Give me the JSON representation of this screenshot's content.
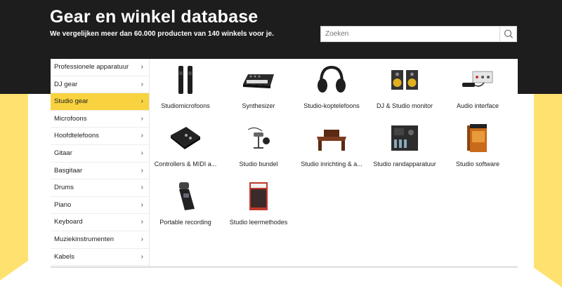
{
  "header": {
    "title": "Gear en winkel database",
    "subtitle": "We vergelijken meer dan 60.000 producten van 140 winkels voor je."
  },
  "search": {
    "placeholder": "Zoeken",
    "icon": "search-icon"
  },
  "sidebar": {
    "items": [
      {
        "label": "Professionele apparatuur",
        "active": false
      },
      {
        "label": "DJ gear",
        "active": false
      },
      {
        "label": "Studio gear",
        "active": true
      },
      {
        "label": "Microfoons",
        "active": false
      },
      {
        "label": "Hoofdtelefoons",
        "active": false
      },
      {
        "label": "Gitaar",
        "active": false
      },
      {
        "label": "Basgitaar",
        "active": false
      },
      {
        "label": "Drums",
        "active": false
      },
      {
        "label": "Piano",
        "active": false
      },
      {
        "label": "Keyboard",
        "active": false
      },
      {
        "label": "Muziekinstrumenten",
        "active": false
      },
      {
        "label": "Kabels",
        "active": false
      }
    ],
    "chevron": "chevron-right-icon"
  },
  "categories": [
    {
      "label": "Studiomicrofoons",
      "icon": "studio-microphones-image"
    },
    {
      "label": "Synthesizer",
      "icon": "synthesizer-image"
    },
    {
      "label": "Studio-koptelefoons",
      "icon": "studio-headphones-image"
    },
    {
      "label": "DJ & Studio monitor",
      "icon": "studio-monitor-image"
    },
    {
      "label": "Audio interface",
      "icon": "audio-interface-image"
    },
    {
      "label": "Controllers & MIDI a...",
      "icon": "midi-controller-image"
    },
    {
      "label": "Studio bundel",
      "icon": "studio-bundle-image"
    },
    {
      "label": "Studio inrichting & a...",
      "icon": "studio-furniture-image"
    },
    {
      "label": "Studio randapparatuur",
      "icon": "studio-peripheral-image"
    },
    {
      "label": "Studio software",
      "icon": "studio-software-image"
    },
    {
      "label": "Portable recording",
      "icon": "portable-recorder-image"
    },
    {
      "label": "Studio leermethodes",
      "icon": "studio-book-image"
    }
  ],
  "colors": {
    "header_bg": "#1d1d1d",
    "accent_yellow": "#f8d33f",
    "background_yellow": "#ffe16f"
  }
}
